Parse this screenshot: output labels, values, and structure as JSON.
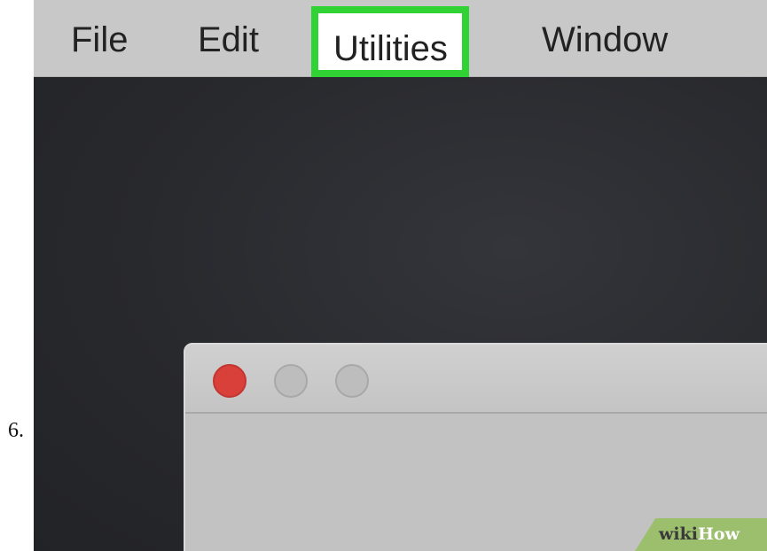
{
  "step": {
    "number": "6."
  },
  "menubar": {
    "items": [
      {
        "label": "File"
      },
      {
        "label": "Edit"
      },
      {
        "label": "Utilities",
        "highlighted": true
      },
      {
        "label": "Window"
      }
    ],
    "highlight_color": "#31d233"
  },
  "window": {
    "traffic_lights": {
      "close_color": "#d9403a",
      "minimize_color": "#bdbdbd",
      "zoom_color": "#bdbdbd"
    }
  },
  "watermark": {
    "part1": "wiki",
    "part2": "How",
    "color": "#9bbf6c"
  }
}
